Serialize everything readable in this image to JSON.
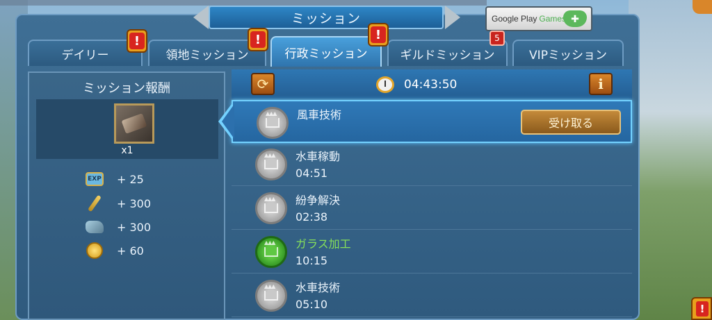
{
  "window": {
    "title": "ミッション",
    "google_play": {
      "label_main": "Google Play",
      "label_games": "Games"
    }
  },
  "tabs": [
    {
      "label": "デイリー",
      "active": false,
      "alert": true
    },
    {
      "label": "領地ミッション",
      "active": false,
      "alert": true
    },
    {
      "label": "行政ミッション",
      "active": true,
      "alert": true
    },
    {
      "label": "ギルドミッション",
      "active": false,
      "badge": "5"
    },
    {
      "label": "VIPミッション",
      "active": false
    }
  ],
  "alert_glyph": "!",
  "reward_panel": {
    "title": "ミッション報酬",
    "item_qty": "x1",
    "rewards": [
      {
        "icon": "exp-icon",
        "icon_text": "EXP",
        "value": "+ 25"
      },
      {
        "icon": "wheat-icon",
        "value": "+ 300"
      },
      {
        "icon": "stone-icon",
        "value": "+ 300"
      },
      {
        "icon": "gold-coin-icon",
        "value": "+ 60"
      }
    ]
  },
  "list_header": {
    "timer": "04:43:50",
    "info_label": "i"
  },
  "missions": [
    {
      "name": "風車技術",
      "time": "",
      "status": "complete",
      "button": "受け取る"
    },
    {
      "name": "水車稼動",
      "time": "04:51",
      "status": "locked"
    },
    {
      "name": "紛争解決",
      "time": "02:38",
      "status": "locked"
    },
    {
      "name": "ガラス加工",
      "time": "10:15",
      "status": "active"
    },
    {
      "name": "水車技術",
      "time": "05:10",
      "status": "locked"
    }
  ],
  "colors": {
    "accent": "#74d2ff",
    "active_mission": "#86e05a",
    "alert": "#d8251f"
  }
}
